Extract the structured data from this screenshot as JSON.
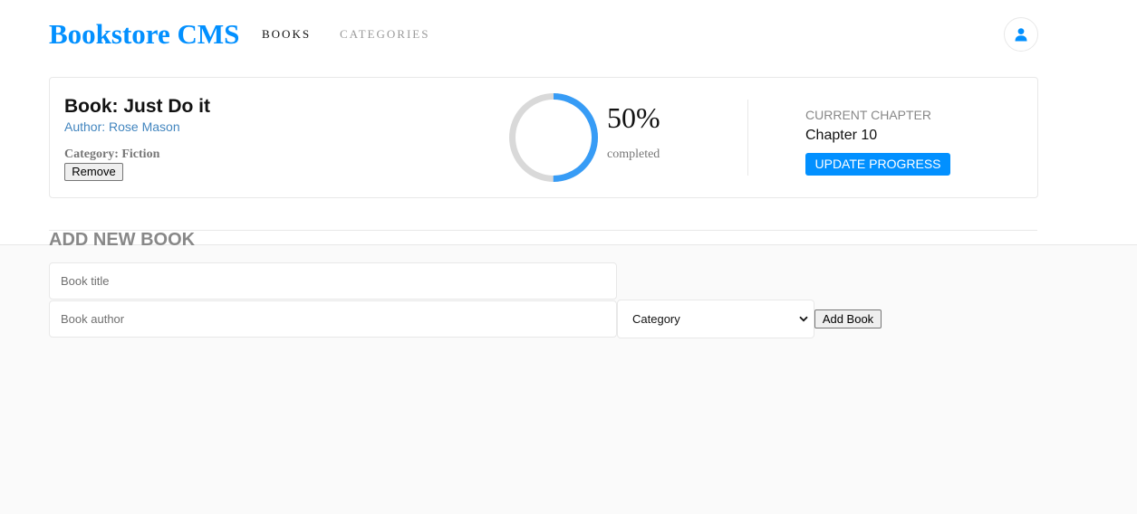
{
  "header": {
    "brand": "Bookstore CMS",
    "nav": [
      {
        "label": "BOOKS"
      },
      {
        "label": "CATEGORIES"
      }
    ],
    "avatar_icon": "user-icon"
  },
  "book": {
    "title": "Book: Just Do it",
    "author": "Author: Rose Mason",
    "category": "Category: Fiction",
    "remove_label": "Remove",
    "progress": {
      "percent_value": 50,
      "percent_text": "50%",
      "completed_text": "completed"
    },
    "chapter": {
      "label": "CURRENT CHAPTER",
      "value": "Chapter 10",
      "update_label": "UPDATE PROGRESS"
    }
  },
  "add_form": {
    "heading": "ADD NEW BOOK",
    "title_placeholder": "Book title",
    "author_placeholder": "Book author",
    "category_selected": "Category",
    "submit_label": "Add Book"
  },
  "colors": {
    "brand": "#0290ff",
    "author_link": "#4386bf",
    "progress_fill": "#379cf6",
    "progress_track": "#d9d9d9"
  }
}
